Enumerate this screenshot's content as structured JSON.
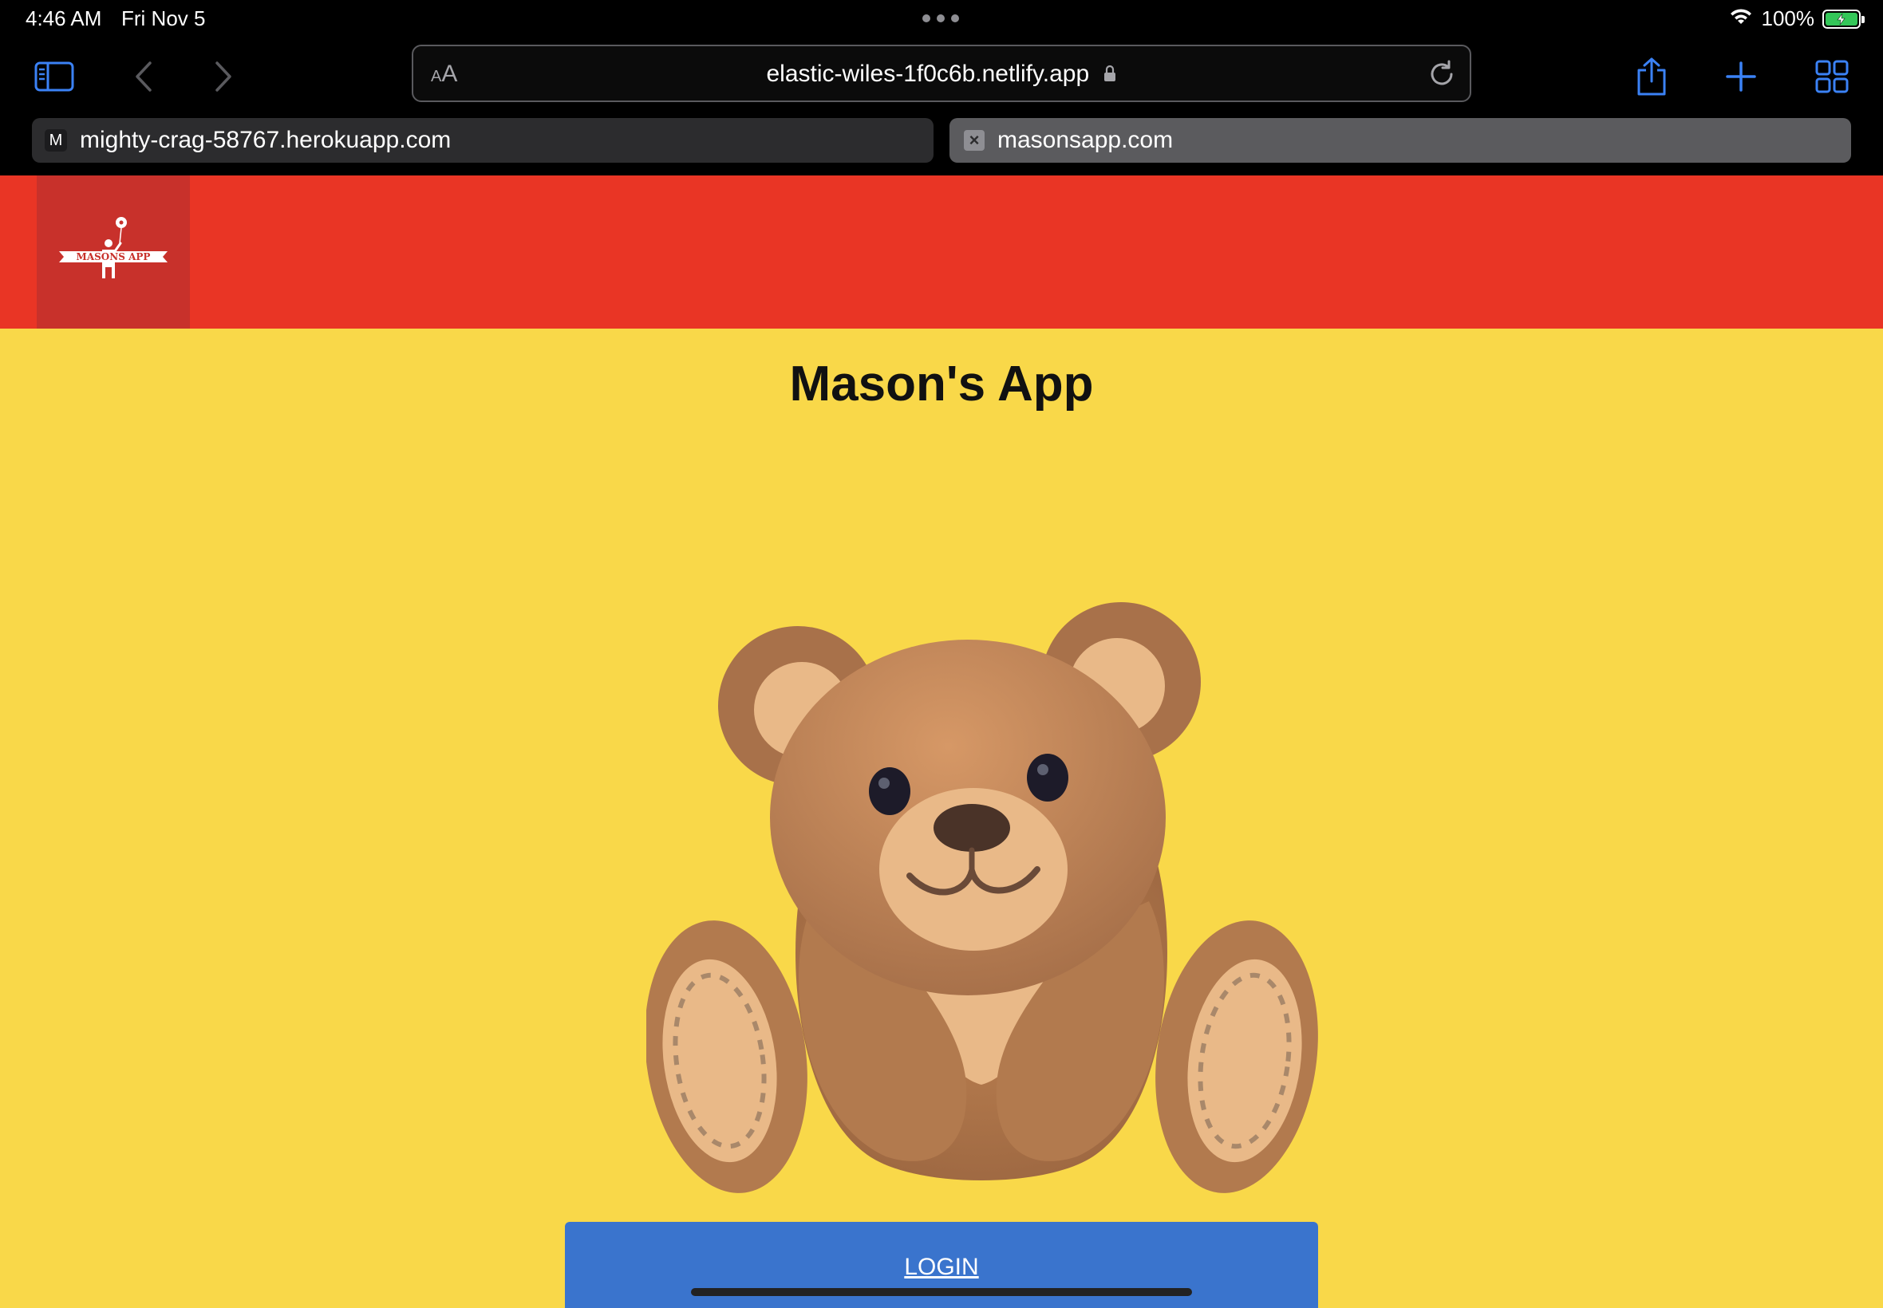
{
  "status_bar": {
    "time": "4:46 AM",
    "date": "Fri Nov 5",
    "battery": "100%"
  },
  "browser": {
    "url": "elastic-wiles-1f0c6b.netlify.app",
    "text_size_small": "A",
    "text_size_large": "A",
    "tabs": [
      {
        "favicon": "M",
        "label": "mighty-crag-58767.herokuapp.com"
      },
      {
        "favicon": "close-icon",
        "label": "masonsapp.com"
      }
    ]
  },
  "page": {
    "logo_text": "MASONS APP",
    "title": "Mason's App",
    "login_label": "LOGIN"
  },
  "colors": {
    "header": "#e93525",
    "logo_bg": "#c8312b",
    "page_bg": "#f9d849",
    "button": "#3a74cd",
    "browser_accent": "#3b82f6"
  }
}
